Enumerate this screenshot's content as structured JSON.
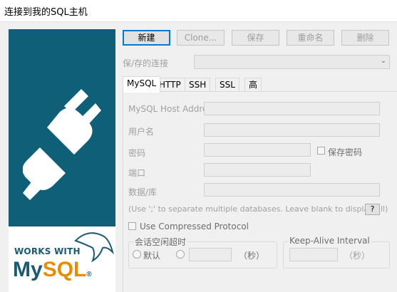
{
  "window": {
    "title": "连接到我的SQL主机"
  },
  "toolbar": {
    "new_label": "新建",
    "clone_label": "Clone...",
    "save_label": "保存",
    "rename_label": "重命名",
    "delete_label": "删除"
  },
  "saved_connection": {
    "label": "保/存的连接",
    "value": ""
  },
  "tabs": [
    {
      "label": "MySQL",
      "active": true
    },
    {
      "label": "HTTP"
    },
    {
      "label": "SSH"
    },
    {
      "label": "SSL"
    },
    {
      "label": "高级功能"
    }
  ],
  "form": {
    "host_label": "MySQL Host Address",
    "host_value": "",
    "username_label": "用户名",
    "username_value": "",
    "password_label": "密码",
    "password_value": "",
    "save_password_label": "保存密码",
    "port_label": "端口",
    "port_value": "",
    "database_label": "数据/库",
    "database_value": "",
    "database_hint": "(Use ';' to separate multiple databases. Leave blank to display all)",
    "help_label": "?",
    "compressed_label": "Use Compressed Protocol",
    "idle_group_title": "会话空闲超时",
    "default_label": "默认",
    "idle_unit": "（秒）",
    "keepalive_group_title": "Keep-Alive Interval",
    "keepalive_unit": "（秒）"
  },
  "branding": {
    "works_with": "WORKS WITH",
    "my": "My",
    "sql": "SQL",
    "reg": "®"
  },
  "colors": {
    "sidebar": "#0f5f79",
    "logo_blue": "#1b5a72",
    "logo_orange": "#e48e00"
  }
}
